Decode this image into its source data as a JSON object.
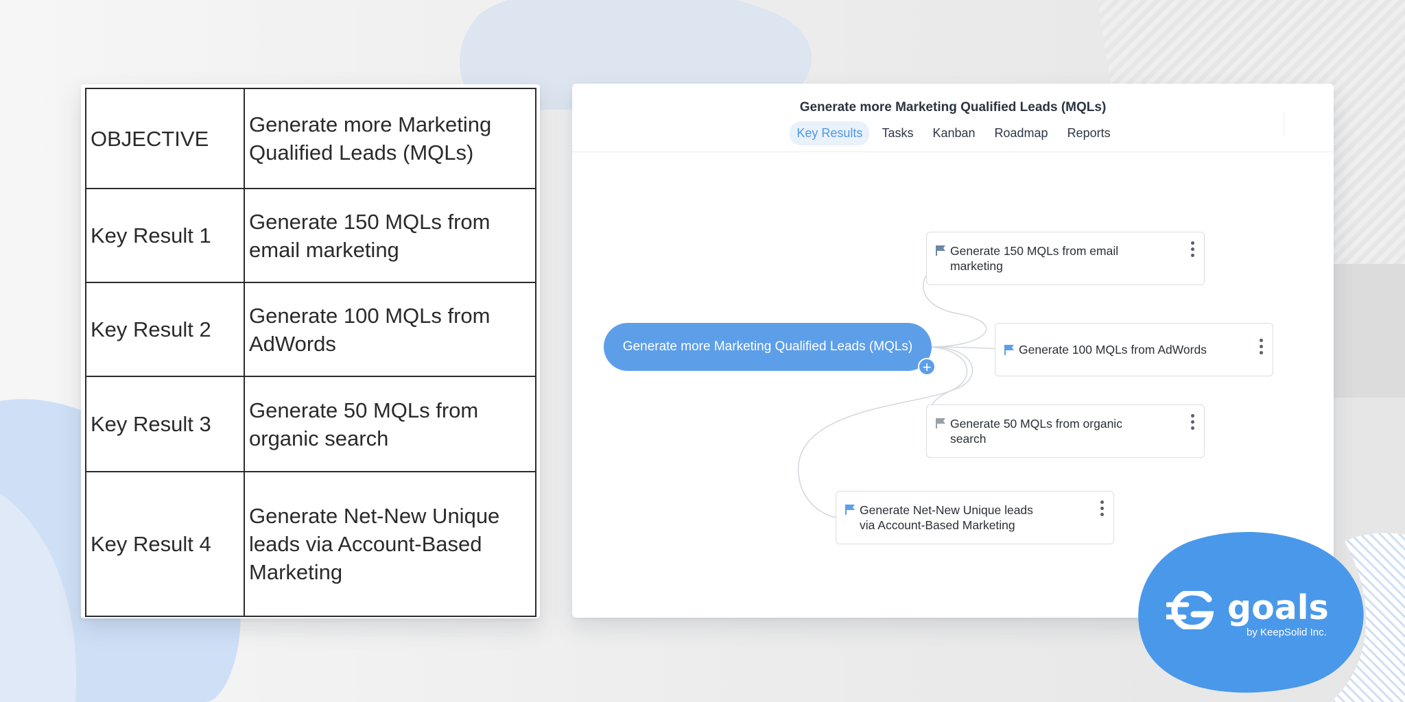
{
  "okr_table": {
    "rows": [
      {
        "label": "OBJECTIVE",
        "text": "Generate more Marketing Qualified Leads (MQLs)"
      },
      {
        "label": "Key Result 1",
        "text": "Generate 150 MQLs from email marketing"
      },
      {
        "label": "Key Result 2",
        "text": "Generate 100 MQLs from AdWords"
      },
      {
        "label": "Key Result 3",
        "text": "Generate 50 MQLs from organic search"
      },
      {
        "label": "Key Result 4",
        "text": "Generate Net-New Unique leads via Account-Based Marketing"
      }
    ]
  },
  "app": {
    "title": "Generate more Marketing Qualified Leads (MQLs)",
    "tabs": [
      {
        "label": "Key Results",
        "active": true
      },
      {
        "label": "Tasks",
        "active": false
      },
      {
        "label": "Kanban",
        "active": false
      },
      {
        "label": "Roadmap",
        "active": false
      },
      {
        "label": "Reports",
        "active": false
      }
    ],
    "objective_node": "Generate more Marketing Qualified Leads (MQLs)",
    "add_icon": "plus-icon",
    "key_results": [
      {
        "text": "Generate 150 MQLs from email marketing",
        "flag_color": "#6d86a8",
        "menu_icon": "kebab-menu-icon"
      },
      {
        "text": "Generate 100 MQLs from AdWords",
        "flag_color": "#5d9ee9",
        "menu_icon": "kebab-menu-icon"
      },
      {
        "text": "Generate 50 MQLs from organic search",
        "flag_color": "#9aa0a8",
        "menu_icon": "kebab-menu-icon"
      },
      {
        "text": "Generate Net-New Unique leads via Account-Based Marketing",
        "flag_color": "#5d9ee9",
        "menu_icon": "kebab-menu-icon"
      }
    ]
  },
  "brand": {
    "name": "goals",
    "byline": "by KeepSolid Inc.",
    "accent": "#4a98ea"
  }
}
